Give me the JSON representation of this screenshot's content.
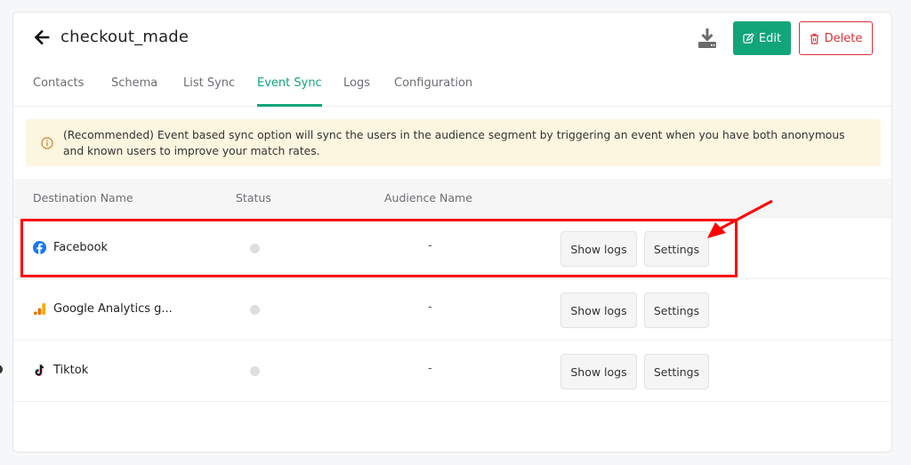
{
  "header": {
    "back_icon": "arrow-left-icon",
    "title": "checkout_made",
    "download_icon": "download-icon",
    "edit_label": "Edit",
    "edit_icon": "edit-icon",
    "delete_label": "Delete",
    "delete_icon": "trash-icon"
  },
  "tabs": [
    {
      "label": "Contacts",
      "active": false
    },
    {
      "label": "Schema",
      "active": false
    },
    {
      "label": "List Sync",
      "active": false
    },
    {
      "label": "Event Sync",
      "active": true
    },
    {
      "label": "Logs",
      "active": false
    },
    {
      "label": "Configuration",
      "active": false
    }
  ],
  "alert": {
    "icon": "info-icon",
    "text": "(Recommended) Event based sync option will sync the users in the audience segment by triggering an event when you have both anonymous and known users to improve your match rates."
  },
  "table": {
    "columns": [
      "Destination Name",
      "Status",
      "Audience Name"
    ],
    "rows": [
      {
        "destination": "Facebook",
        "icon": "facebook-icon",
        "status": "inactive",
        "audience": "-",
        "show_logs": "Show logs",
        "settings": "Settings",
        "highlighted": true
      },
      {
        "destination": "Google Analytics g...",
        "icon": "google-analytics-icon",
        "status": "inactive",
        "audience": "-",
        "show_logs": "Show logs",
        "settings": "Settings",
        "highlighted": false
      },
      {
        "destination": "Tiktok",
        "icon": "tiktok-icon",
        "status": "inactive",
        "audience": "-",
        "show_logs": "Show logs",
        "settings": "Settings",
        "highlighted": false
      }
    ]
  },
  "colors": {
    "accent": "#12a57a",
    "danger": "#d8333a",
    "alert_bg": "#fcf5df",
    "annotation": "#ff0000"
  }
}
